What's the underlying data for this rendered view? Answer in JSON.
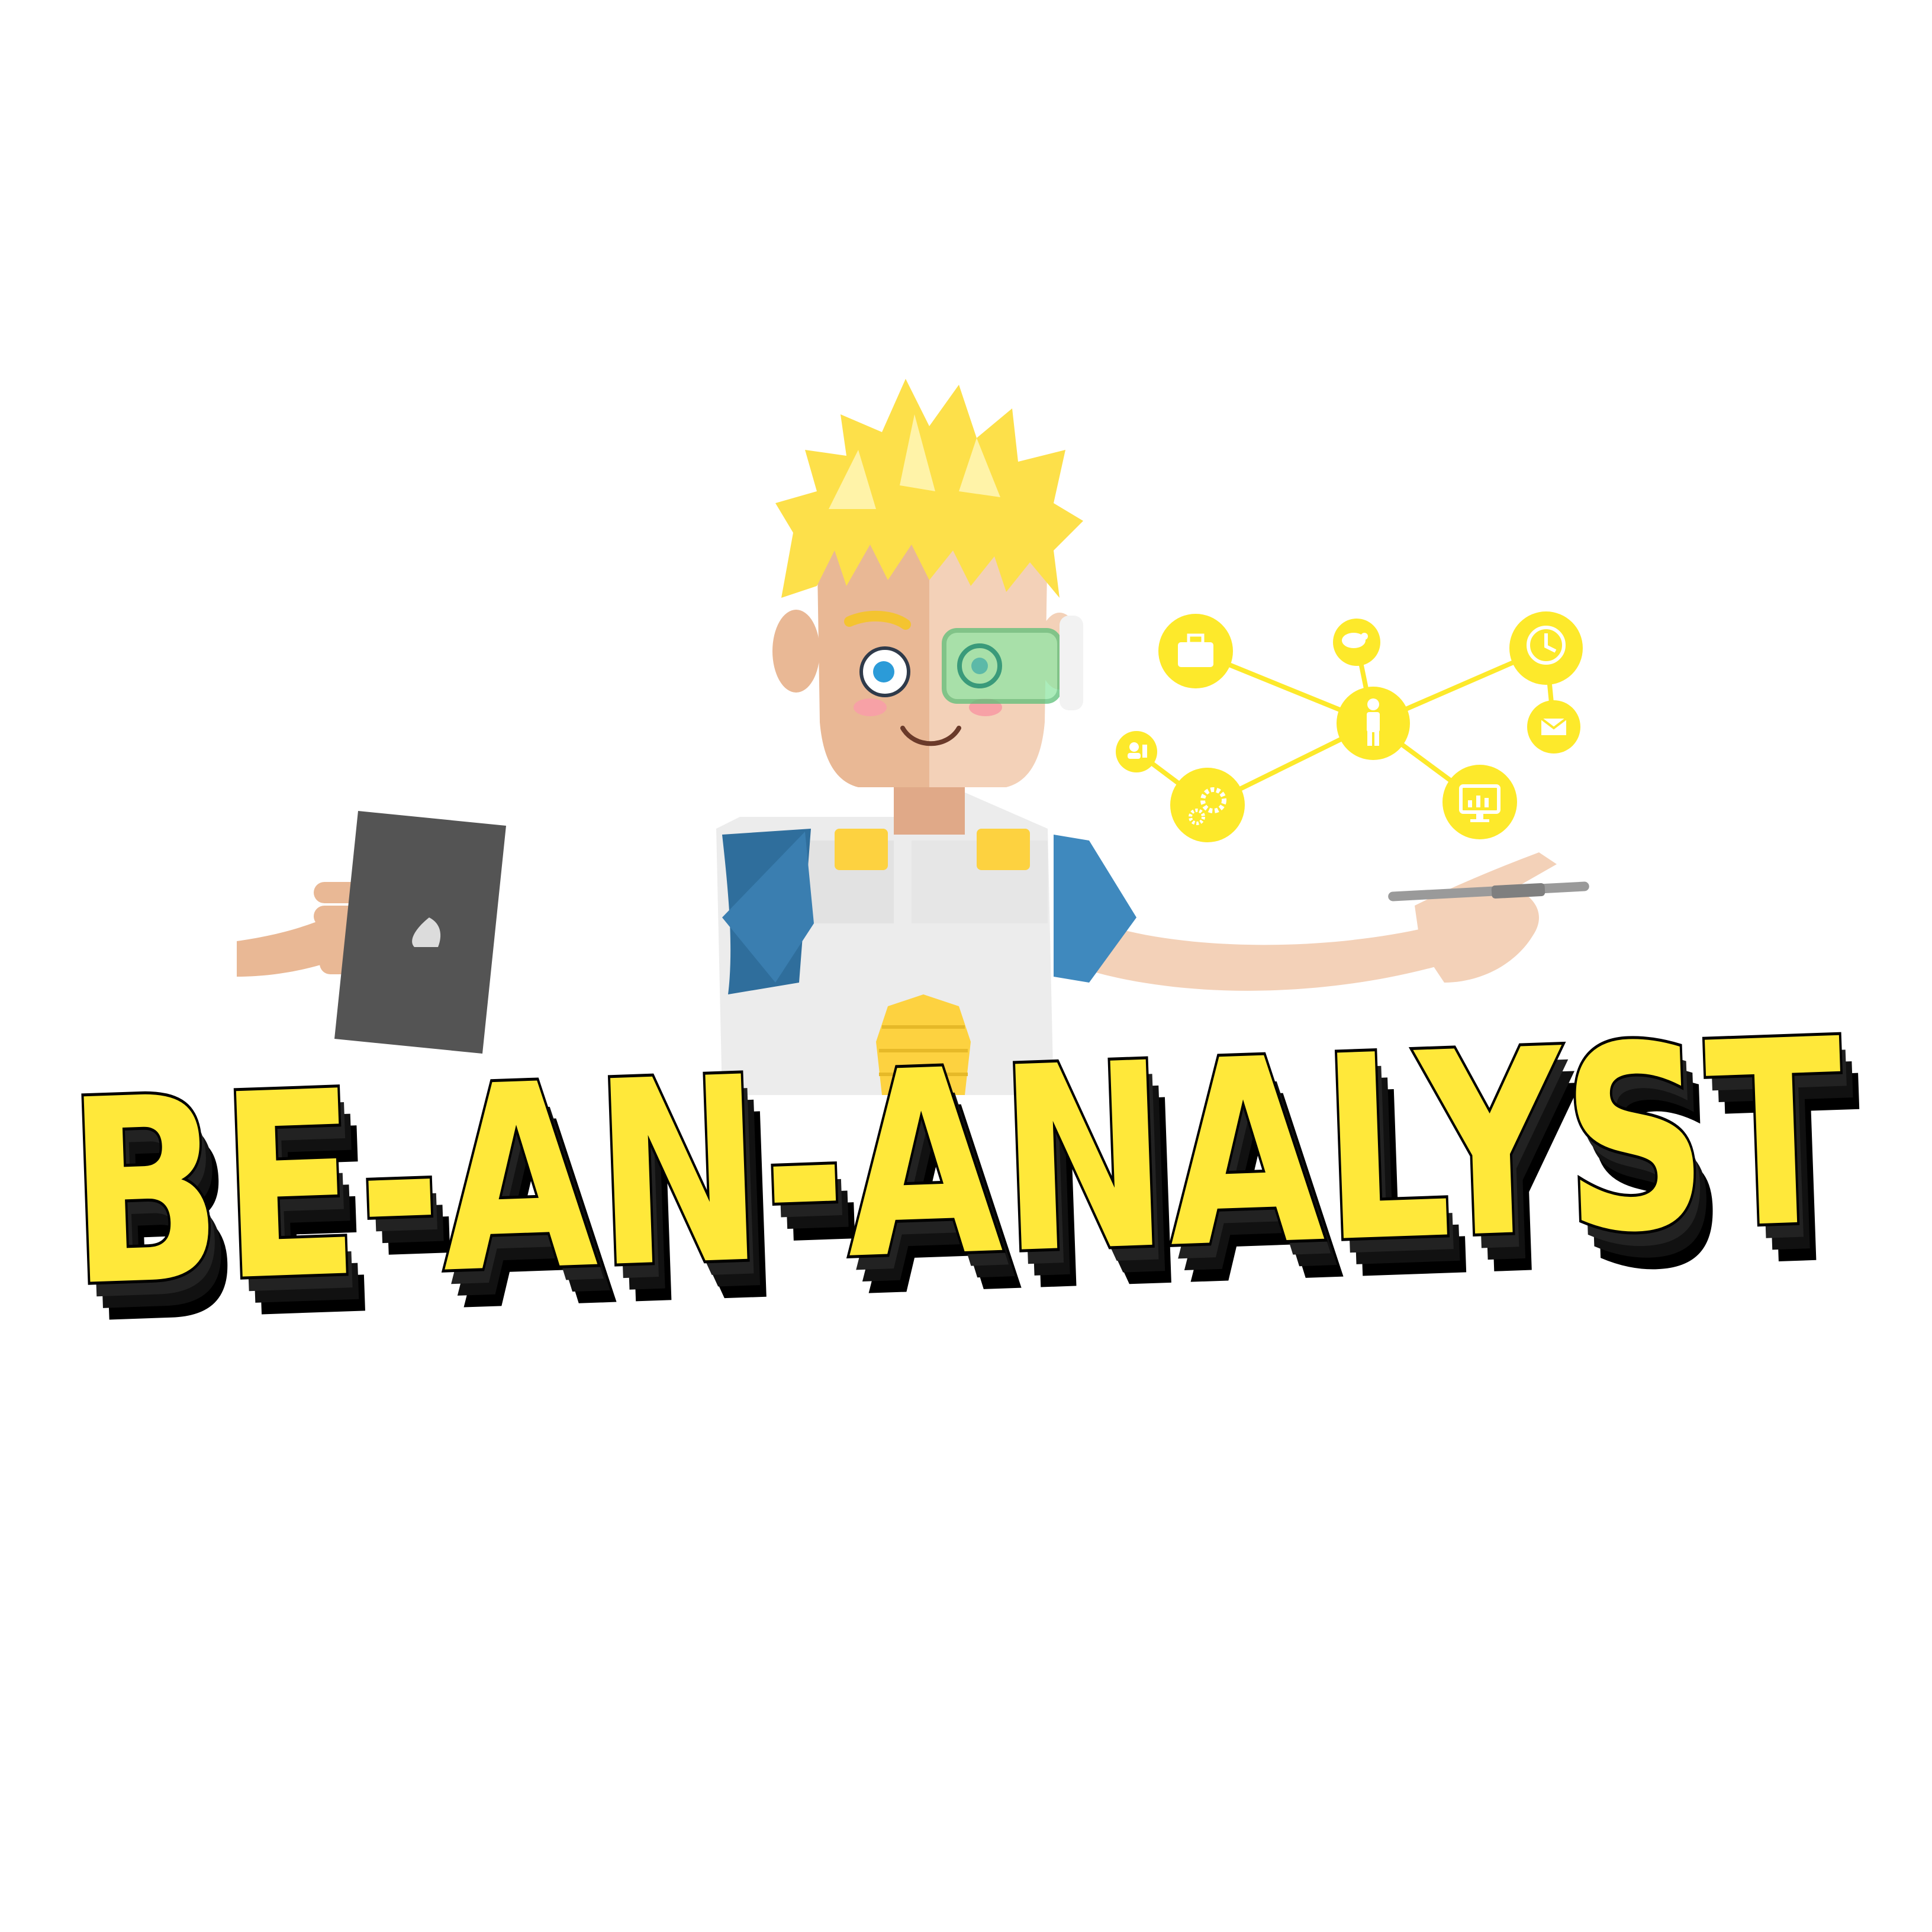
{
  "logo": {
    "text": "BE-AN-ANALYST"
  },
  "colors": {
    "background": "#ffffff",
    "brand_yellow": "#ffe83a",
    "network_yellow": "#fde92b",
    "outline": "#000000",
    "skin_light": "#f3d1b8",
    "skin_dark": "#e9b895",
    "sleeve_blue": "#2f6e9c",
    "tablet_gray": "#545454",
    "visor_green": "#8fe6a4"
  },
  "icons": [
    "briefcase-icon",
    "chat-icon",
    "clock-icon",
    "envelope-icon",
    "person-icon",
    "contacts-icon",
    "gears-icon",
    "monitor-chart-icon"
  ]
}
